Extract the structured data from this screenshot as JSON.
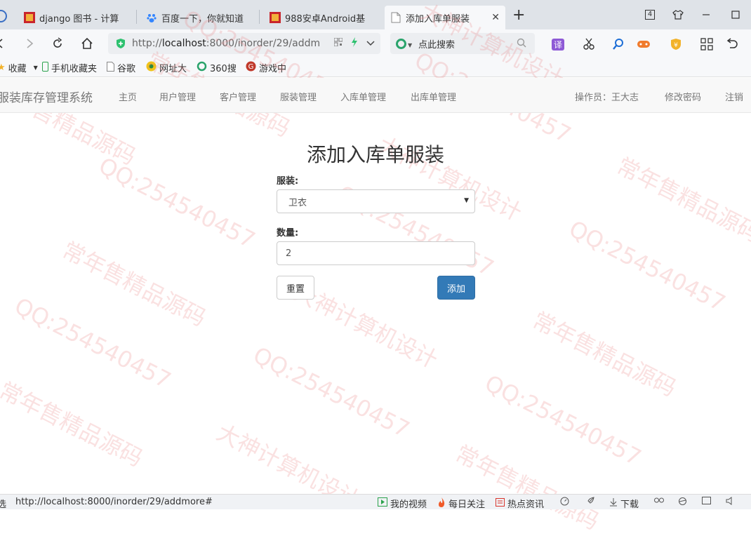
{
  "browser": {
    "tabs": [
      {
        "label": "django 图书 - 计算"
      },
      {
        "label": "百度一下，你就知道"
      },
      {
        "label": "988安卓Android基"
      },
      {
        "label": "添加入库单服装"
      }
    ],
    "tab_count": "4",
    "url": {
      "prefix": "http://",
      "host": "localhost",
      "rest": ":8000/inorder/29/addm"
    },
    "search_placeholder": "点此搜索",
    "translate_label": "译",
    "bookmarks": [
      {
        "label": "收藏"
      },
      {
        "label": "手机收藏夹"
      },
      {
        "label": "谷歌"
      },
      {
        "label": "网址大"
      },
      {
        "label": "360搜"
      },
      {
        "label": "游戏中"
      }
    ]
  },
  "navbar": {
    "brand": "服装库存管理系统",
    "links": [
      "主页",
      "用户管理",
      "客户管理",
      "服装管理",
      "入库单管理",
      "出库单管理"
    ],
    "operator": "操作员：王大志",
    "change_password": "修改密码",
    "logout": "注销"
  },
  "form": {
    "title": "添加入库单服装",
    "clothing_label": "服装:",
    "clothing_value": "卫衣",
    "quantity_label": "数量:",
    "quantity_value": "2",
    "reset_label": "重置",
    "submit_label": "添加"
  },
  "watermark": {
    "lines": [
      "QQ:254540457",
      "常年售精品源码",
      "大神计算机设计"
    ]
  },
  "statusbar": {
    "left_text": "选",
    "url": "http://localhost:8000/inorder/29/addmore#",
    "items": [
      "我的视频",
      "每日关注",
      "热点资讯",
      "下载"
    ]
  }
}
